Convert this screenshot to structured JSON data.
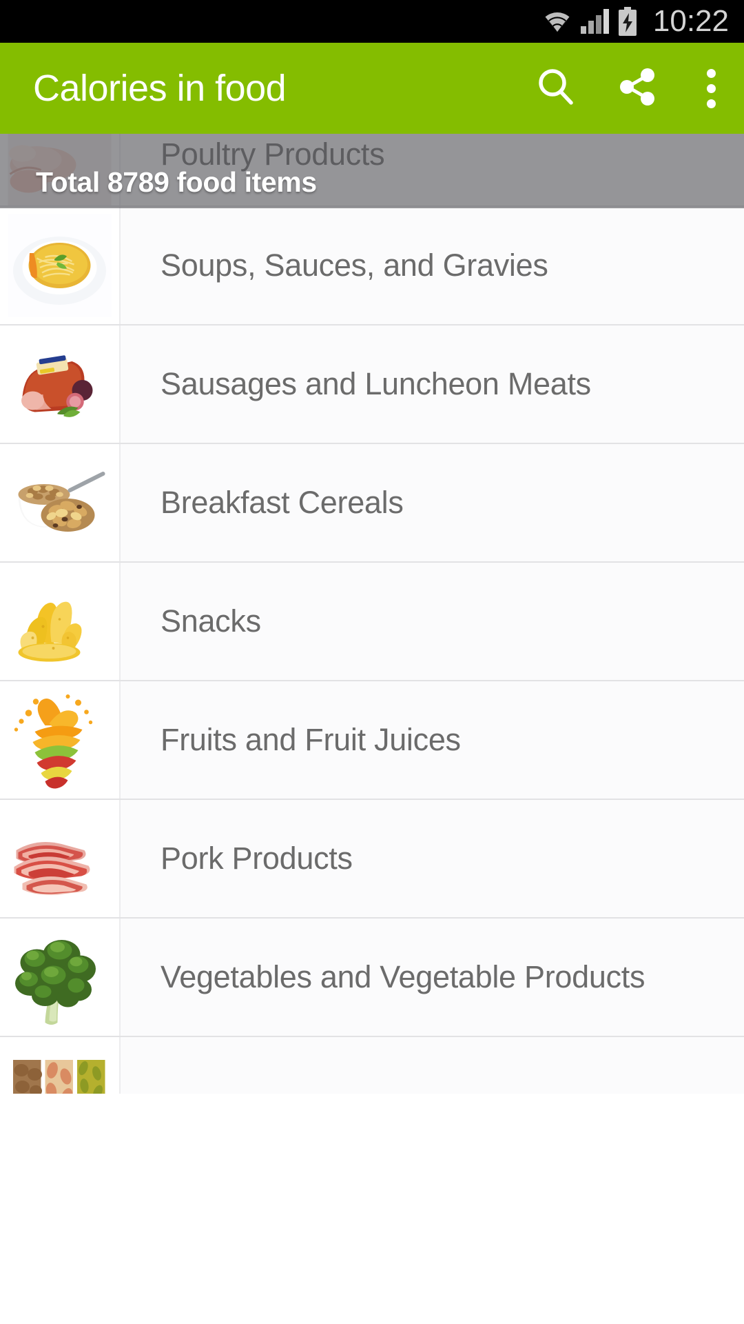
{
  "status_bar": {
    "time": "10:22",
    "icons": [
      "wifi-icon",
      "cellular-signal-icon",
      "battery-charging-icon"
    ]
  },
  "app_bar": {
    "title": "Calories in food",
    "background_color": "#84bd00",
    "title_color": "#ffffff",
    "actions": [
      {
        "name": "search",
        "label": "Search",
        "icon": "search-icon"
      },
      {
        "name": "share",
        "label": "Share",
        "icon": "share-icon"
      },
      {
        "name": "overflow",
        "label": "More options",
        "icon": "overflow-menu-icon"
      }
    ]
  },
  "banner": {
    "text": "Total 8789 food items",
    "background_color": "#56565a",
    "text_color": "#ffffff"
  },
  "list": {
    "partial_top_item": {
      "label": "Poultry Products",
      "thumbnail": "raw-poultry-chicken-photo"
    },
    "items": [
      {
        "label": "Soups, Sauces, and Gravies",
        "thumbnail": "noodle-soup-bowl-photo"
      },
      {
        "label": "Sausages and Luncheon Meats",
        "thumbnail": "smoked-ham-loaf-photo"
      },
      {
        "label": "Breakfast Cereals",
        "thumbnail": "cereal-bowl-with-spoon-photo"
      },
      {
        "label": "Snacks",
        "thumbnail": "potato-chips-pile-photo"
      },
      {
        "label": "Fruits and Fruit Juices",
        "thumbnail": "fruit-slices-juice-splash-photo"
      },
      {
        "label": "Pork Products",
        "thumbnail": "raw-bacon-slices-photo"
      },
      {
        "label": "Vegetables and Vegetable Products",
        "thumbnail": "broccoli-head-photo"
      }
    ],
    "partial_bottom_item": {
      "label": "",
      "thumbnail": "nuts-seeds-legumes-trio-photo"
    },
    "row_text_color": "#6b6b6b",
    "row_background_color": "#fbfbfc",
    "divider_color": "#e2e2e4"
  }
}
